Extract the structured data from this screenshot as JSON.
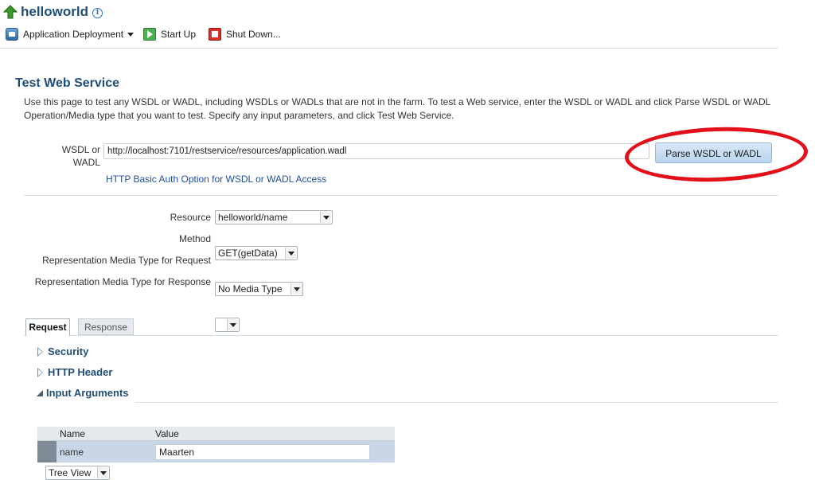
{
  "header": {
    "app_name": "helloworld",
    "info_glyph": "i",
    "toolbar": {
      "deploy_label": "Application Deployment",
      "start_label": "Start Up",
      "shutdown_label": "Shut Down..."
    }
  },
  "page": {
    "title": "Test Web Service",
    "description_line1": "Use this page to test any WSDL or WADL, including WSDLs or WADLs that are not in the farm. To test a Web service, enter the WSDL or WADL and click Parse WSDL or WADL",
    "description_line2": "Operation/Media type that you want to test. Specify any input parameters, and click Test Web Service."
  },
  "wsdl": {
    "label_line1": "WSDL or",
    "label_line2": "WADL",
    "value": "http://localhost:7101/restservice/resources/application.wadl",
    "parse_button": "Parse WSDL or WADL",
    "auth_link": "HTTP Basic Auth Option for WSDL or WADL Access",
    "highlight_color": "#e3101a"
  },
  "form": {
    "resource_label": "Resource",
    "resource_value": "helloworld/name",
    "method_label": "Method",
    "method_value": "GET(getData)",
    "req_media_label": "Representation Media Type for Request",
    "req_media_value": "No Media Type",
    "resp_media_label": "Representation Media Type for Response",
    "resp_media_value": ""
  },
  "tabs": [
    {
      "label": "Request",
      "selected": true
    },
    {
      "label": "Response",
      "selected": false
    }
  ],
  "sections": {
    "security": "Security",
    "http_header": "HTTP Header",
    "input_arguments": "Input Arguments"
  },
  "input_args": {
    "view_value": "Tree View",
    "columns": [
      "Name",
      "Value"
    ],
    "rows": [
      {
        "name": "name",
        "value": "Maarten"
      }
    ]
  },
  "colors": {
    "brand_title": "#1f4e79",
    "link": "#1f4e9a",
    "selected_row": "#c9d6e5"
  }
}
